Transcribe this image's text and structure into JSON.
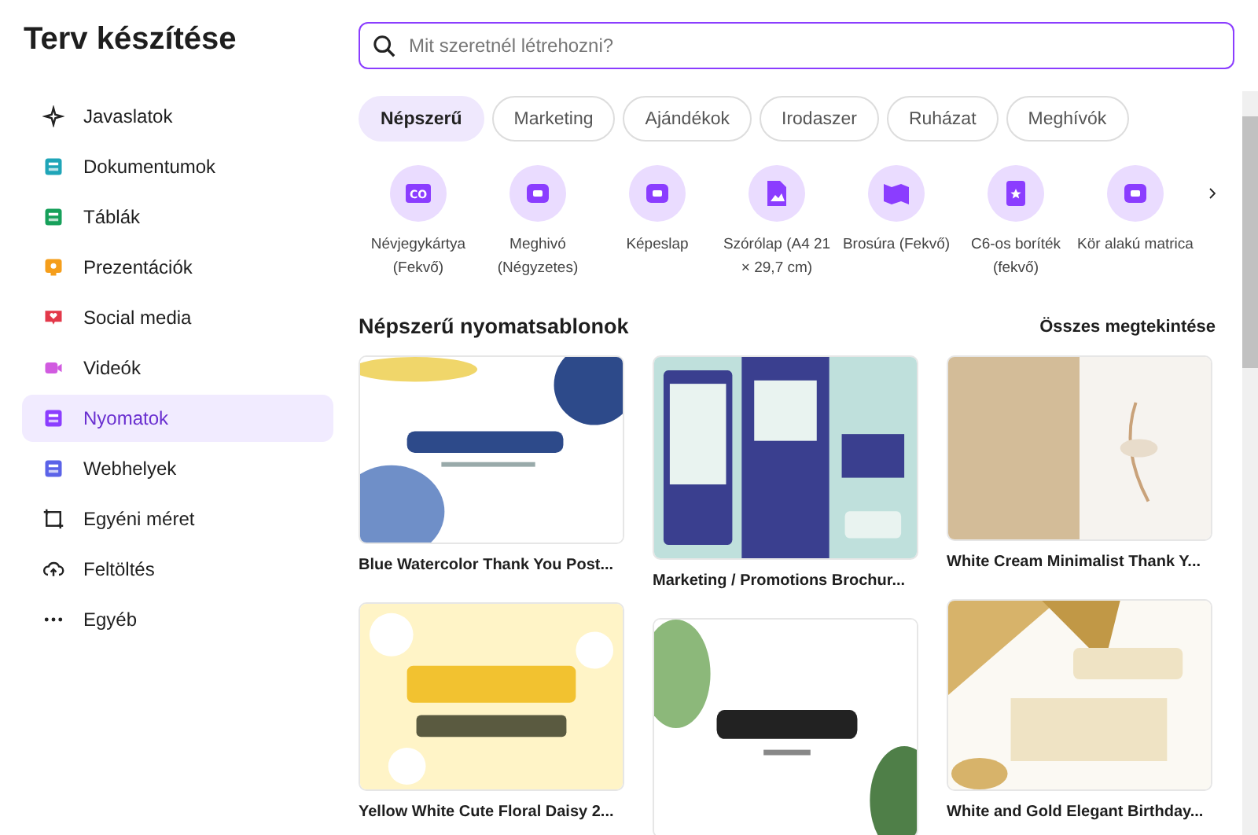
{
  "sidebar": {
    "title": "Terv készítése",
    "items": [
      {
        "label": "Javaslatok",
        "selected": false
      },
      {
        "label": "Dokumentumok",
        "selected": false
      },
      {
        "label": "Táblák",
        "selected": false
      },
      {
        "label": "Prezentációk",
        "selected": false
      },
      {
        "label": "Social media",
        "selected": false
      },
      {
        "label": "Videók",
        "selected": false
      },
      {
        "label": "Nyomatok",
        "selected": true
      },
      {
        "label": "Webhelyek",
        "selected": false
      },
      {
        "label": "Egyéni méret",
        "selected": false
      },
      {
        "label": "Feltöltés",
        "selected": false
      },
      {
        "label": "Egyéb",
        "selected": false
      }
    ]
  },
  "search": {
    "placeholder": "Mit szeretnél létrehozni?"
  },
  "tabs": [
    {
      "label": "Népszerű",
      "selected": true
    },
    {
      "label": "Marketing",
      "selected": false
    },
    {
      "label": "Ajándékok",
      "selected": false
    },
    {
      "label": "Irodaszer",
      "selected": false
    },
    {
      "label": "Ruházat",
      "selected": false
    },
    {
      "label": "Meghívók",
      "selected": false
    }
  ],
  "categories": [
    {
      "label": "Névjegykártya (Fekvő)",
      "icon_text": "CO"
    },
    {
      "label": "Meghivó (Négyzetes)"
    },
    {
      "label": "Képeslap"
    },
    {
      "label": "Szórólap (A4 21 × 29,7 cm)"
    },
    {
      "label": "Brosúra (Fekvő)"
    },
    {
      "label": "C6-os boríték (fekvő)"
    },
    {
      "label": "Kör alakú matrica"
    }
  ],
  "section": {
    "title": "Népszerű nyomatsablonok",
    "link": "Összes megtekintése"
  },
  "templates": [
    {
      "title": "Blue Watercolor Thank You Post..."
    },
    {
      "title": "Marketing / Promotions Brochur..."
    },
    {
      "title": "White Cream Minimalist Thank Y..."
    },
    {
      "title": "Yellow White Cute Floral Daisy 2..."
    },
    {
      "title": "White and Gold Elegant Birthday..."
    }
  ]
}
